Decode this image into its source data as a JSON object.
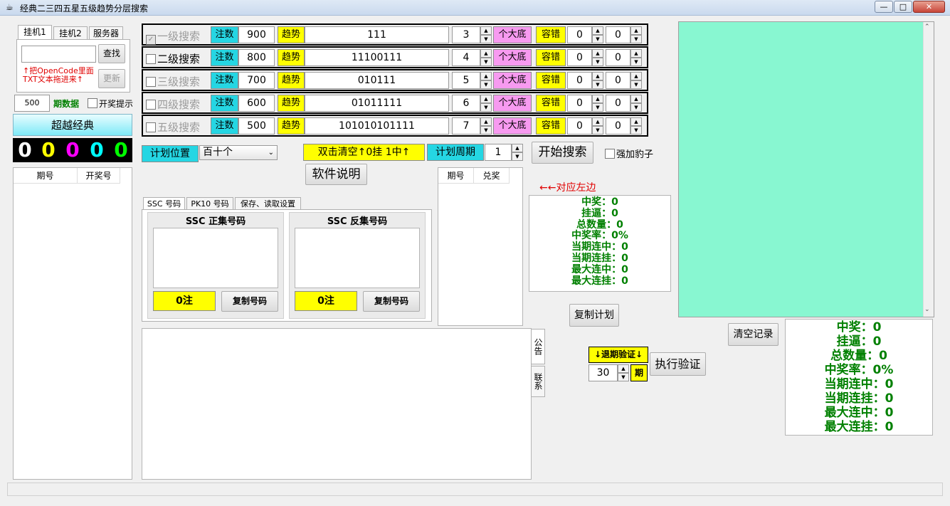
{
  "window": {
    "title": "经典二三四五星五级趋势分层搜索",
    "min": "—",
    "max": "□",
    "close": "✕"
  },
  "tabs_top": [
    "挂机1",
    "挂机2",
    "服务器"
  ],
  "left": {
    "search_input": "",
    "find_btn": "查找",
    "update_btn": "更新",
    "hint_line1": "↑把OpenCode里面",
    "hint_line2": "TXT文本拖进来↑",
    "period_count": "500",
    "period_label": "期数据",
    "lottery_tip": "开奖提示",
    "super_classic": "超越经典",
    "digits": [
      "0",
      "0",
      "0",
      "0",
      "0"
    ],
    "table_headers": [
      "期号",
      "开奖号"
    ]
  },
  "levels": [
    {
      "label": "一级搜索",
      "checked": true,
      "disabled": true,
      "bet_label": "注数",
      "bet": "900",
      "trend_label": "趋势",
      "pattern": "111",
      "spin": "3",
      "bottom_label": "个大底",
      "tol_label": "容错",
      "tol1": "0",
      "tol2": "0"
    },
    {
      "label": "二级搜索",
      "checked": false,
      "disabled": false,
      "bet_label": "注数",
      "bet": "800",
      "trend_label": "趋势",
      "pattern": "11100111",
      "spin": "4",
      "bottom_label": "个大底",
      "tol_label": "容错",
      "tol1": "0",
      "tol2": "0"
    },
    {
      "label": "三级搜索",
      "checked": false,
      "disabled": true,
      "bet_label": "注数",
      "bet": "700",
      "trend_label": "趋势",
      "pattern": "010111",
      "spin": "5",
      "bottom_label": "个大底",
      "tol_label": "容错",
      "tol1": "0",
      "tol2": "0"
    },
    {
      "label": "四级搜索",
      "checked": false,
      "disabled": true,
      "bet_label": "注数",
      "bet": "600",
      "trend_label": "趋势",
      "pattern": "01011111",
      "spin": "6",
      "bottom_label": "个大底",
      "tol_label": "容错",
      "tol1": "0",
      "tol2": "0"
    },
    {
      "label": "五级搜索",
      "checked": false,
      "disabled": true,
      "bet_label": "注数",
      "bet": "500",
      "trend_label": "趋势",
      "pattern": "101010101111",
      "spin": "7",
      "bottom_label": "个大底",
      "tol_label": "容错",
      "tol1": "0",
      "tol2": "0"
    }
  ],
  "plan": {
    "position_label": "计划位置",
    "position_value": "百十个",
    "clear_label": "双击清空↑0挂 1中↑",
    "cycle_label": "计划周期",
    "cycle_value": "1",
    "start_btn": "开始搜索",
    "leopard": "强加豹子",
    "manual_btn": "软件说明"
  },
  "code_tabs": [
    "SSC 号码",
    "PK10 号码",
    "保存、读取设置"
  ],
  "pos_set": {
    "title": "SSC 正集号码",
    "count": "0注",
    "copy": "复制号码"
  },
  "neg_set": {
    "title": "SSC 反集号码",
    "count": "0注",
    "copy": "复制号码"
  },
  "mid_table_headers": [
    "期号",
    "兑奖"
  ],
  "side_tabs": [
    "公告",
    "联系"
  ],
  "arrow_note": "←←对应左边",
  "stats_small": [
    "中奖：0",
    "挂逼：0",
    "总数量：0",
    "中奖率：0%",
    "当期连中：0",
    "当期连挂：0",
    "最大连中：0",
    "最大连挂：0"
  ],
  "copy_plan": "复制计划",
  "clear_record": "清空记录",
  "backtest": {
    "label": "↓退期验证↓",
    "value": "30",
    "unit": "期",
    "run": "执行验证"
  },
  "stats_big": [
    "中奖：0",
    "挂逼：0",
    "总数量：0",
    "中奖率：0%",
    "当期连中：0",
    "当期连挂：0",
    "最大连中：0",
    "最大连挂：0"
  ],
  "colors": {
    "cyan": "#25d6e3",
    "yellow": "#ffff00",
    "pink": "#f79af0",
    "mint": "#88f7d1",
    "stat_green": "#008000",
    "digit_colors": [
      "#ffffff",
      "#ffff00",
      "#ff00ff",
      "#00ffff",
      "#00ff00"
    ]
  }
}
